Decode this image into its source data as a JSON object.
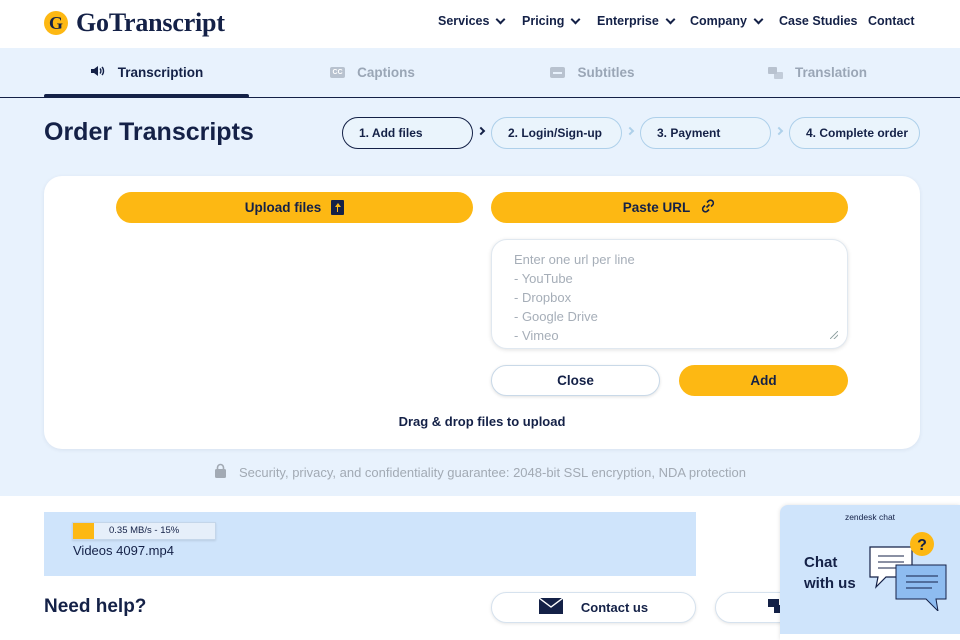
{
  "header": {
    "logo_mark": "G",
    "logo_text": "GoTranscript",
    "nav": [
      {
        "label": "Services"
      },
      {
        "label": "Pricing"
      },
      {
        "label": "Enterprise"
      },
      {
        "label": "Company"
      },
      {
        "label": "Case Studies"
      },
      {
        "label": "Contact"
      }
    ]
  },
  "tabs": [
    {
      "label": "Transcription",
      "active": true,
      "icon": "speaker-icon"
    },
    {
      "label": "Captions",
      "active": false,
      "icon": "cc-icon"
    },
    {
      "label": "Subtitles",
      "active": false,
      "icon": "subtitles-icon"
    },
    {
      "label": "Translation",
      "active": false,
      "icon": "translate-icon"
    }
  ],
  "order": {
    "title": "Order Transcripts",
    "steps": [
      {
        "label": "1. Add files",
        "active": true
      },
      {
        "label": "2. Login/Sign-up",
        "active": false
      },
      {
        "label": "3. Payment",
        "active": false
      },
      {
        "label": "4. Complete order",
        "active": false
      }
    ]
  },
  "upload": {
    "upload_label": "Upload files",
    "paste_label": "Paste URL",
    "url_placeholder": "Enter one url per line\n- YouTube\n- Dropbox\n- Google Drive\n- Vimeo",
    "close_label": "Close",
    "add_label": "Add",
    "drag_text": "Drag & drop files to upload"
  },
  "security_text": "Security, privacy, and confidentiality guarantee: 2048-bit SSL encryption, NDA protection",
  "file": {
    "progress_text": "0.35 MB/s - 15%",
    "progress_percent": 15,
    "name": "Videos 4097.mp4"
  },
  "help": {
    "title": "Need help?",
    "contact_label": "Contact us"
  },
  "chat": {
    "brand": "zendesk chat",
    "label": "Chat\nwith us"
  },
  "colors": {
    "accent_yellow": "#fdb813",
    "navy": "#142147",
    "page_bg": "#e8f2fd",
    "file_box_bg": "#cfe4fb"
  }
}
